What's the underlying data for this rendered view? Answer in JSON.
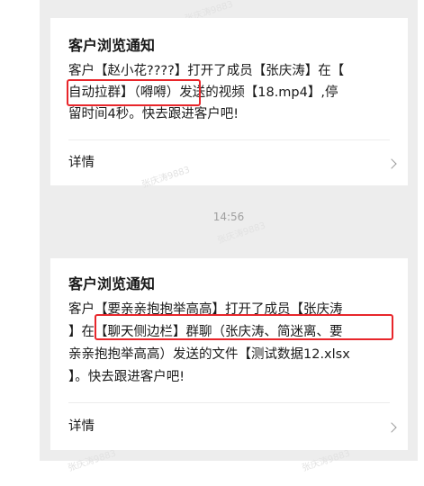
{
  "time_label": "14:56",
  "watermark": "张庆涛9883",
  "notifications": [
    {
      "title": "客户浏览通知",
      "lines": [
        "客户【赵小花????】打开了成员【张庆涛】在【",
        "自动拉群】（嘚嘚）发送的视频【18.mp4】,停",
        "留时间4秒。快去跟进客户吧!"
      ],
      "detail": "详情"
    },
    {
      "title": "客户浏览通知",
      "lines": [
        "客户【要亲亲抱抱举高高】打开了成员【张庆涛",
        "】在【聊天侧边栏】群聊（张庆涛、简迷离、要",
        "亲亲抱抱举高高）发送的文件【测试数据12.xlsx",
        "】。快去跟进客户吧!"
      ],
      "detail": "详情"
    }
  ],
  "colors": {
    "highlight": "#e8262b",
    "background": "#ededed",
    "card": "#ffffff"
  }
}
